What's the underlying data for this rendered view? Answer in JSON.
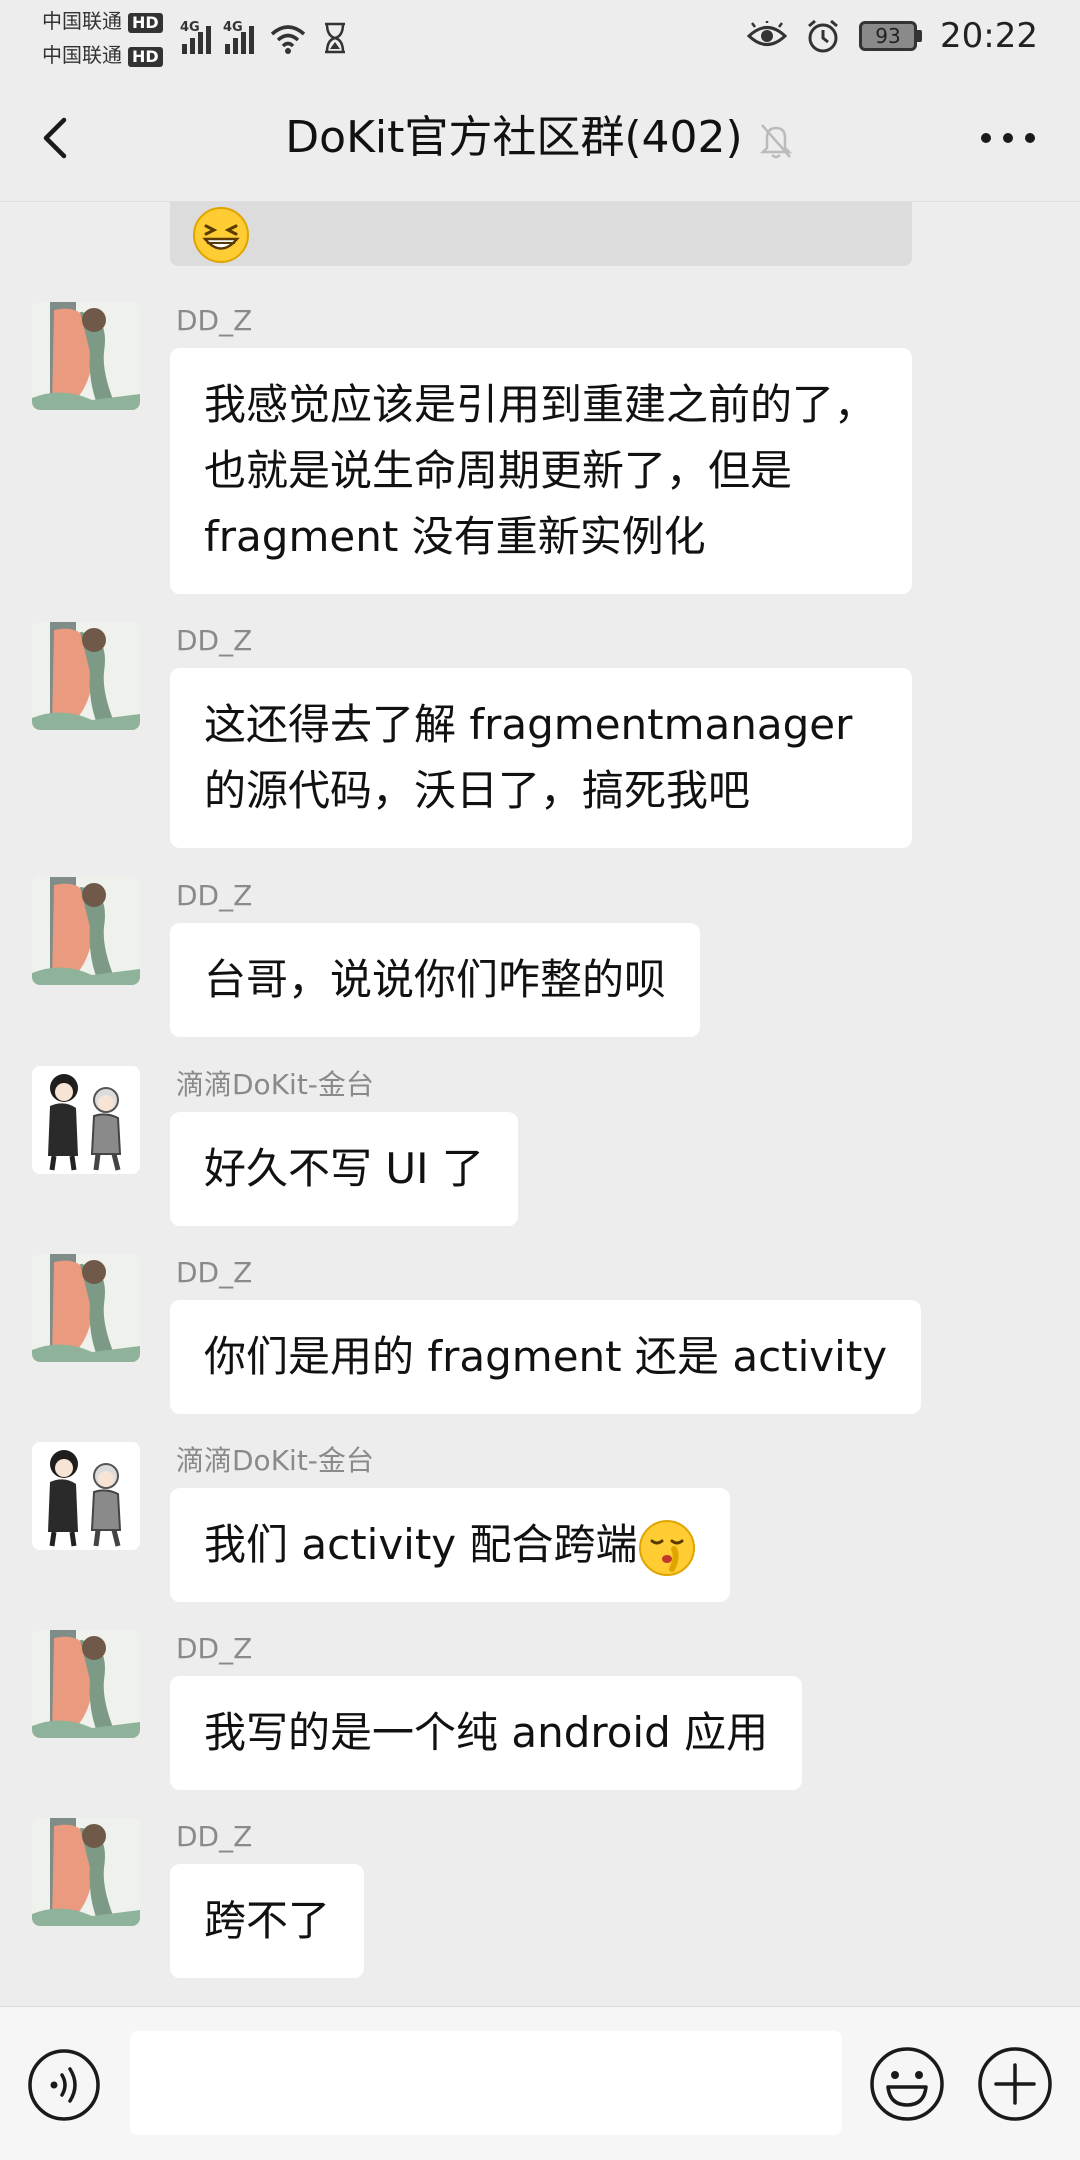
{
  "status_bar": {
    "carrier_1": "中国联通",
    "carrier_2": "中国联通",
    "hd_badge": "HD",
    "network_1": "4G",
    "network_2": "4G",
    "battery_level": "93",
    "time": "20:22",
    "icons": [
      "signal-icon",
      "wifi-icon",
      "hourglass-icon",
      "eye-icon",
      "alarm-icon",
      "battery-icon"
    ]
  },
  "nav": {
    "title": "DoKit官方社区群(402)",
    "back_icon": "back-arrow-icon",
    "mute_icon": "mute-bell-icon",
    "more_icon": "more-dots-icon"
  },
  "messages": [
    {
      "sender": "DD_Z",
      "avatar": "tree-figure-avatar",
      "text": "我感觉应该是引用到重建之前的了，也就是说生命周期更新了，但是 fragment 没有重新实例化"
    },
    {
      "sender": "DD_Z",
      "avatar": "tree-figure-avatar",
      "text": "这还得去了解 fragmentmanager 的源代码，沃日了，搞死我吧"
    },
    {
      "sender": "DD_Z",
      "avatar": "tree-figure-avatar",
      "text": "台哥，说说你们咋整的呗"
    },
    {
      "sender": "滴滴DoKit-金台",
      "avatar": "two-figures-avatar",
      "text": "好久不写 UI 了"
    },
    {
      "sender": "DD_Z",
      "avatar": "tree-figure-avatar",
      "text": "你们是用的 fragment 还是 activity"
    },
    {
      "sender": "滴滴DoKit-金台",
      "avatar": "two-figures-avatar",
      "text": "我们 activity 配合跨端",
      "emoji": "shushing-face-emoji"
    },
    {
      "sender": "DD_Z",
      "avatar": "tree-figure-avatar",
      "text": "我写的是一个纯 android 应用"
    },
    {
      "sender": "DD_Z",
      "avatar": "tree-figure-avatar",
      "text": "跨不了"
    }
  ],
  "partial_message": {
    "emoji": "grinning-squint-emoji"
  },
  "input_bar": {
    "voice_icon": "voice-icon",
    "emoji_icon": "emoji-icon",
    "plus_icon": "plus-icon",
    "input_value": ""
  },
  "colors": {
    "background": "#ededed",
    "bubble": "#ffffff",
    "sender_text": "#8a8a8a"
  }
}
